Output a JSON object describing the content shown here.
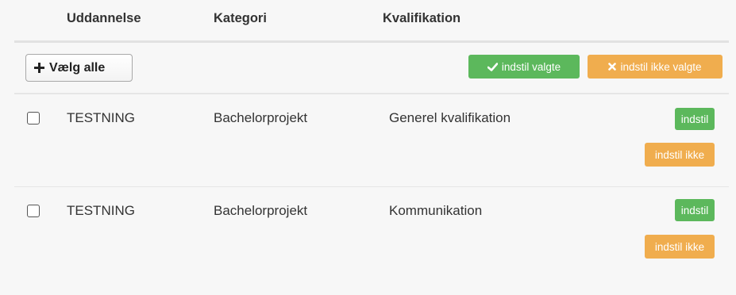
{
  "table": {
    "headers": {
      "education": "Uddannelse",
      "category": "Kategori",
      "qualification": "Kvalifikation"
    },
    "toolbar": {
      "select_all_label": "Vælg alle",
      "set_selected_label": "indstil valgte",
      "unset_selected_label": "indstil ikke valgte"
    },
    "rows": [
      {
        "education": "TESTNING",
        "category": "Bachelorprojekt",
        "qualification": "Generel kvalifikation",
        "set_label": "indstil",
        "unset_label": "indstil ikke"
      },
      {
        "education": "TESTNING",
        "category": "Bachelorprojekt",
        "qualification": "Kommunikation",
        "set_label": "indstil",
        "unset_label": "indstil ikke"
      }
    ]
  },
  "colors": {
    "success": "#5cb85c",
    "warning": "#f0ad4e",
    "background": "#f7f7f7"
  }
}
